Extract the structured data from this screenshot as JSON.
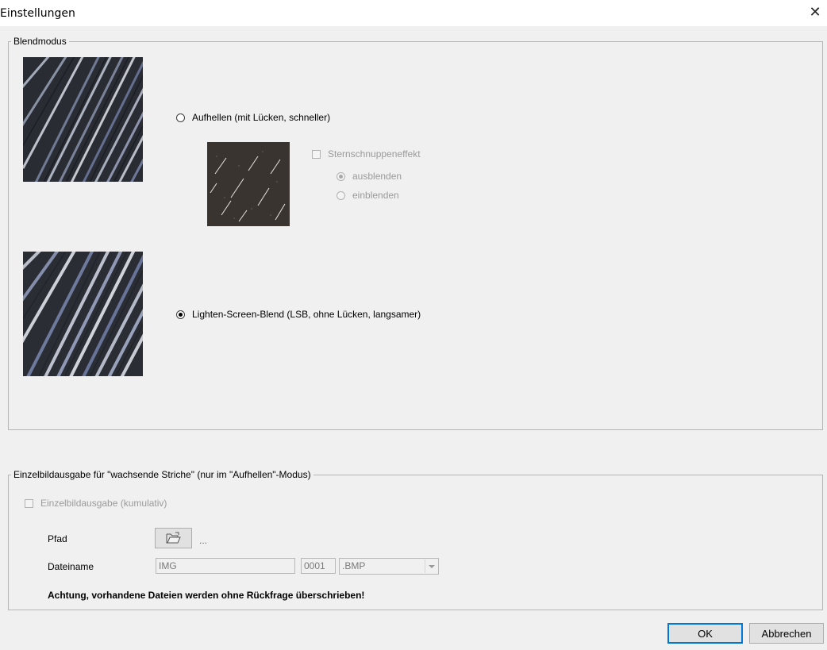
{
  "window": {
    "title": "Einstellungen",
    "close_glyph": "✕"
  },
  "blend_group": {
    "legend": "Blendmodus",
    "option_lighten": {
      "label": "Aufhellen (mit Lücken, schneller)",
      "checked": false
    },
    "meteor": {
      "label": "Sternschnuppeneffekt",
      "checked": false,
      "enabled": false,
      "options": [
        {
          "label": "ausblenden",
          "checked": true
        },
        {
          "label": "einblenden",
          "checked": false
        }
      ]
    },
    "option_lsb": {
      "label": "Lighten-Screen-Blend (LSB, ohne Lücken, langsamer)",
      "checked": true
    }
  },
  "single_group": {
    "legend": "Einzelbildausgabe für \"wachsende Striche\" (nur im \"Aufhellen\"-Modus)",
    "enable_label": "Einzelbildausgabe (kumulativ)",
    "path_label": "Pfad",
    "path_value": "...",
    "filename_label": "Dateiname",
    "filename_value": "IMG",
    "counter_value": "0001",
    "extension_value": ".BMP",
    "warning": "Achtung, vorhandene Dateien werden ohne Rückfrage überschrieben!"
  },
  "buttons": {
    "ok": "OK",
    "cancel": "Abbrechen"
  },
  "colors": {
    "accent": "#0078d7",
    "disabled_text": "#9a9a9a",
    "dialog_bg": "#f0f0f0"
  },
  "icons": [
    "close-icon",
    "folder-open-icon",
    "chevron-down-icon"
  ]
}
